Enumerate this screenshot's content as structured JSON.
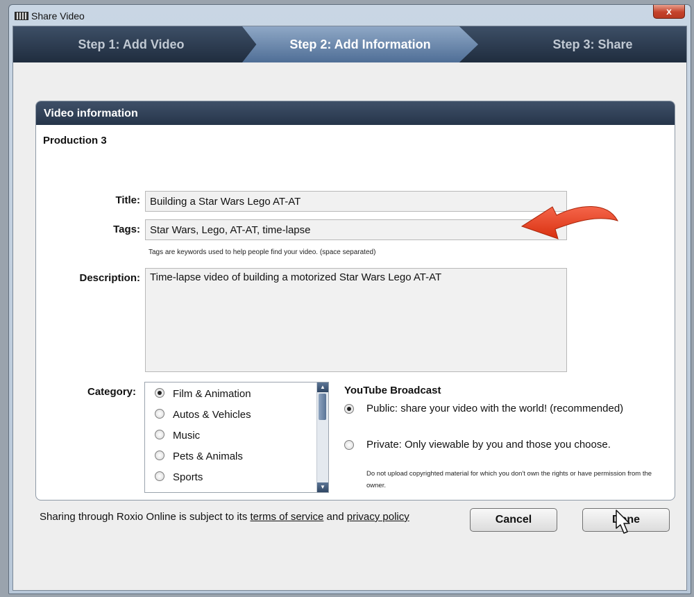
{
  "window": {
    "title": "Share Video",
    "close_label": "x"
  },
  "steps": [
    {
      "label": "Step 1: Add Video",
      "active": false
    },
    {
      "label": "Step 2: Add Information",
      "active": true
    },
    {
      "label": "Step 3: Share",
      "active": false
    }
  ],
  "panel": {
    "header": "Video information",
    "production": "Production 3",
    "title_label": "Title:",
    "title_value": "Building a Star Wars Lego AT-AT",
    "tags_label": "Tags:",
    "tags_value": "Star Wars, Lego, AT-AT, time-lapse",
    "tags_hint": "Tags are keywords used to help people find your video. (space separated)",
    "description_label": "Description:",
    "description_value": "Time-lapse video of building a motorized Star Wars Lego AT-AT",
    "category_label": "Category:",
    "categories": [
      {
        "label": "Film & Animation",
        "selected": true
      },
      {
        "label": "Autos & Vehicles",
        "selected": false
      },
      {
        "label": "Music",
        "selected": false
      },
      {
        "label": "Pets & Animals",
        "selected": false
      },
      {
        "label": "Sports",
        "selected": false
      }
    ],
    "youtube": {
      "title": "YouTube Broadcast",
      "public_label": "Public: share your video with the world! (recommended)",
      "private_label": "Private: Only viewable by you and those you choose.",
      "selected": "public",
      "note": "Do not upload copyrighted material for which you don't own the rights or have permission from the owner."
    }
  },
  "footer": {
    "text_before": "Sharing through Roxio Online is subject to its ",
    "terms_link": "terms of service",
    "text_and": " and ",
    "privacy_link": "privacy policy",
    "cancel_label": "Cancel",
    "done_label": "Done"
  },
  "icons": {
    "annotation": "red-curved-arrow-icon",
    "cursor": "mouse-pointer-icon"
  },
  "colors": {
    "header_dark": "#26354a",
    "step_active": "#4f6e96",
    "annotation_arrow": "#e8401c"
  }
}
